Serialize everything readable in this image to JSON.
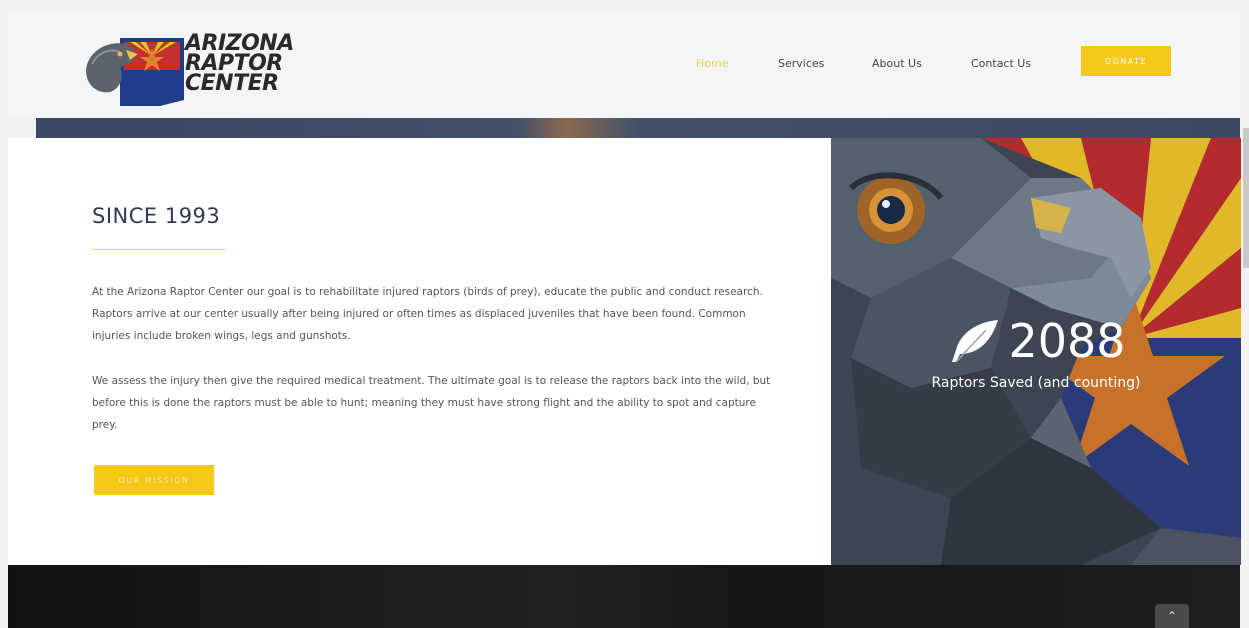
{
  "logo": {
    "lines": [
      "ARIZONA",
      "RAPTOR",
      "CENTER"
    ]
  },
  "nav": {
    "items": [
      {
        "label": "Home",
        "active": true
      },
      {
        "label": "Services",
        "active": false
      },
      {
        "label": "About Us",
        "active": false
      },
      {
        "label": "Contact Us",
        "active": false
      }
    ],
    "donate_label": "DONATE"
  },
  "main": {
    "title": "SINCE 1993",
    "paragraphs": [
      "At the Arizona Raptor Center our goal is to rehabilitate injured raptors (birds of prey), educate the public and conduct research. Raptors arrive at our center usually after being injured or often times as displaced juveniles that have been found. Common injuries include broken wings, legs and gunshots.",
      "We assess the injury then give the required medical treatment. The ultimate goal is to release the raptors back into the wild, but before this is done the raptors must be able to hunt; meaning they must have strong flight and the ability to spot and capture prey."
    ],
    "mission_label": "OUR MISSION"
  },
  "stat": {
    "number": "2088",
    "label": "Raptors Saved (and counting)"
  },
  "scroll_top_icon": "chevron-up-icon",
  "colors": {
    "accent": "#f6c817",
    "title": "#2f3b52",
    "flag_red": "#b52a2c",
    "flag_blue": "#2b3a78",
    "star_copper": "#c8712b"
  }
}
